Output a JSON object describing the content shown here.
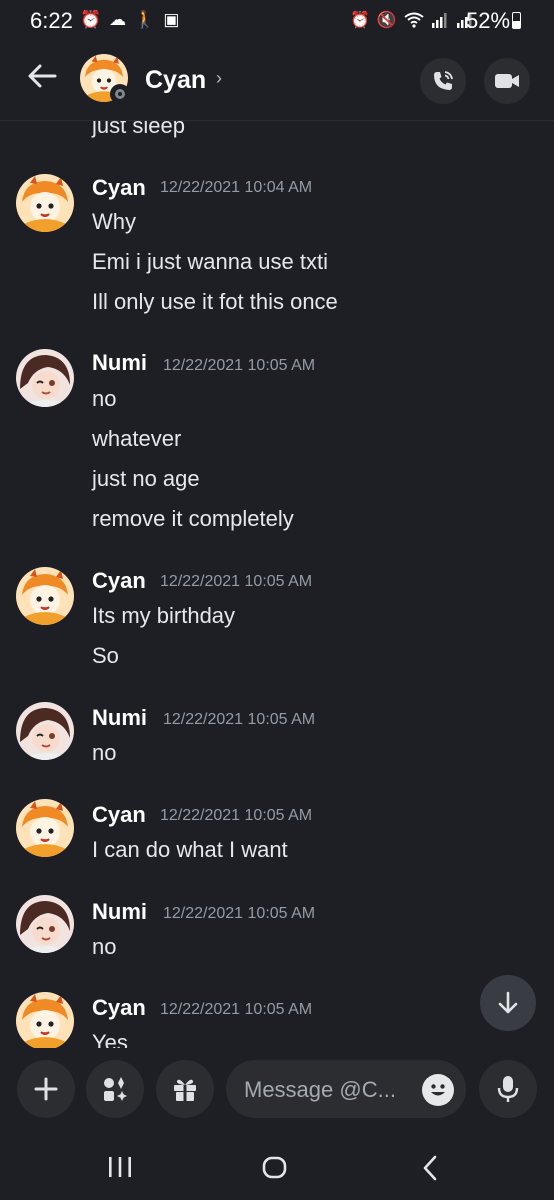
{
  "status_bar": {
    "time": "6:22",
    "battery": "52%",
    "left_icons": [
      "alarm-icon",
      "weather-icon",
      "walking-icon",
      "image-icon"
    ],
    "right_icons": [
      "alarm-icon",
      "mute-icon",
      "wifi-icon",
      "signal-icon",
      "signal-icon"
    ],
    "battery_level": 0.52
  },
  "header": {
    "name": "Cyan",
    "chevron": "›",
    "status": "offline"
  },
  "messages": [
    {
      "type": "continuation",
      "text": "just sleep"
    },
    {
      "type": "group",
      "author": "Cyan",
      "timestamp": "12/22/2021 10:04 AM",
      "lines": [
        "Why",
        "Emi i just wanna use txti",
        "Ill only use it fot this once"
      ]
    },
    {
      "type": "group",
      "author": "Numi",
      "timestamp": "12/22/2021 10:05 AM",
      "lines": [
        "no",
        "whatever",
        "just no age",
        "remove it completely"
      ]
    },
    {
      "type": "group",
      "author": "Cyan",
      "timestamp": "12/22/2021 10:05 AM",
      "lines": [
        "Its my birthday",
        "So"
      ]
    },
    {
      "type": "group",
      "author": "Numi",
      "timestamp": "12/22/2021 10:05 AM",
      "lines": [
        "no"
      ]
    },
    {
      "type": "group",
      "author": "Cyan",
      "timestamp": "12/22/2021 10:05 AM",
      "lines": [
        "I can do what I want"
      ]
    },
    {
      "type": "group",
      "author": "Numi",
      "timestamp": "12/22/2021 10:05 AM",
      "lines": [
        "no"
      ]
    },
    {
      "type": "group",
      "author": "Cyan",
      "timestamp": "12/22/2021 10:05 AM",
      "lines": [
        "Yes"
      ]
    }
  ],
  "composer": {
    "placeholder": "Message @C..."
  },
  "colors": {
    "background": "#1e1f24",
    "button_bg": "#2b2d31",
    "timestamp": "#949ba4",
    "text": "#e6e7ea"
  }
}
